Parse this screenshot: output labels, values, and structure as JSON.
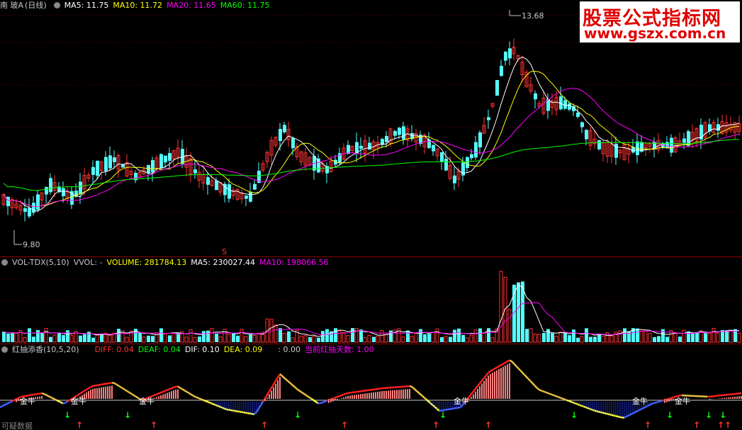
{
  "main": {
    "title": "南 玻A",
    "period": "(日线)",
    "ma5": "MA5: 11.75",
    "ma10": "MA10: 11.72",
    "ma20": "MA20: 11.65",
    "ma60": "MA60: 11.75",
    "high_label": "13.68",
    "low_label": "9.80",
    "marker": "S"
  },
  "volume": {
    "title": "VOL-TDX(5,10)",
    "vvol": "VVOL: -",
    "volume": "VOLUME: 281784.13",
    "ma5": "MA5: 230027.44",
    "ma10": "MA10: 198066.56"
  },
  "indicator": {
    "title": "红抽添香(10,5,20)",
    "diff": "DIFF: 0.04",
    "deaf": "DEAF: 0.04",
    "dif": "DIF: 0.10",
    "dea": "DEA: 0.09",
    "blank": ": 0.00",
    "days": "当前红抽天数: 1.00",
    "jinniu": "金牛",
    "bottom_text": "可疑数据"
  },
  "watermark": {
    "line1": "股票公式指标网",
    "line2": "www.gszx.com.cn"
  },
  "colors": {
    "up": "#ff3232",
    "down": "#54ffff",
    "ma5": "#ffffff",
    "ma10": "#ffff00",
    "ma20": "#ff00ff",
    "ma60": "#00ff00"
  }
}
